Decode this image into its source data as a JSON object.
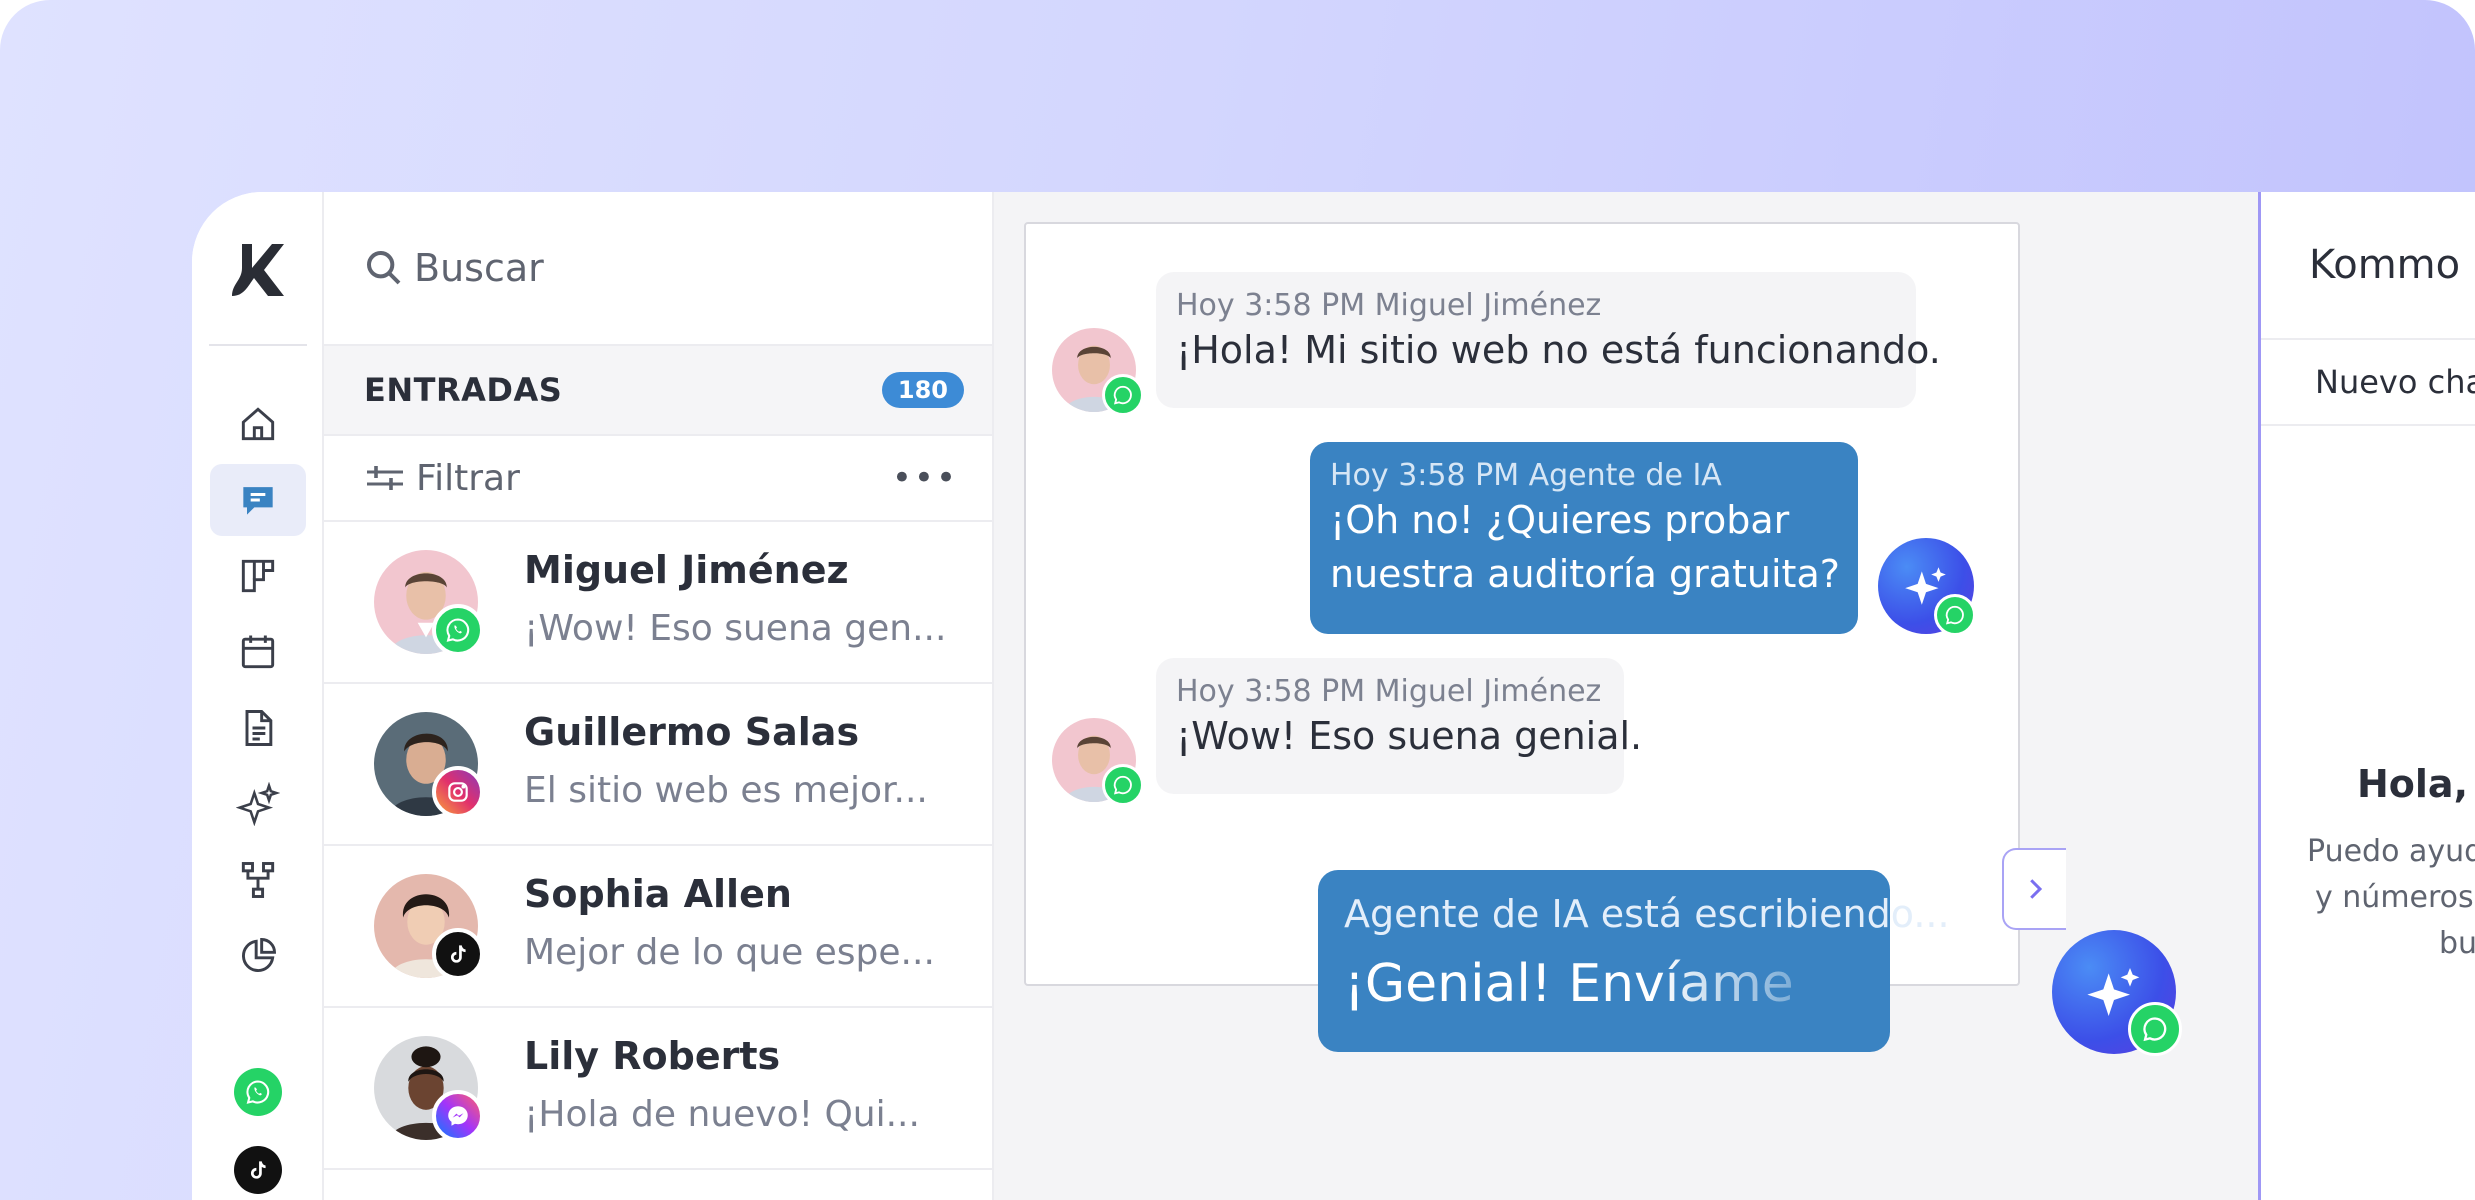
{
  "search": {
    "placeholder": "Buscar"
  },
  "inbox": {
    "title": "ENTRADAS",
    "count": "180"
  },
  "filter": {
    "label": "Filtrar",
    "more": "•••"
  },
  "conversations": [
    {
      "name": "Miguel Jiménez",
      "preview": "¡Wow! Eso suena gen...",
      "channel": "whatsapp"
    },
    {
      "name": "Guillermo Salas",
      "preview": "El sitio web es mejor...",
      "channel": "instagram"
    },
    {
      "name": "Sophia Allen",
      "preview": "Mejor de lo que espe...",
      "channel": "tiktok"
    },
    {
      "name": "Lily Roberts",
      "preview": "¡Hola de nuevo! Qui...",
      "channel": "messenger"
    }
  ],
  "messages": [
    {
      "meta": "Hoy 3:58 PM Miguel Jiménez",
      "text": "¡Hola! Mi sitio web no está funcionando."
    },
    {
      "meta": "Hoy 3:58 PM Agente de IA",
      "line1": "¡Oh no! ¿Quieres probar",
      "line2": "nuestra auditoría gratuita?"
    },
    {
      "meta": "Hoy 3:58 PM Miguel Jiménez",
      "text": "¡Wow! Eso suena genial."
    }
  ],
  "typing": {
    "meta": "Agente de IA está escribiendo...",
    "text": "¡Genial! Envíame"
  },
  "copilot": {
    "title": "Kommo Copilot",
    "tab": "Nuevo chat",
    "heading": "Hola, soy el Analis",
    "desc1": "Puedo ayudarte a analizar",
    "desc2": "y números para mantener",
    "desc3": "buen camino"
  },
  "colors": {
    "accent": "#3a83c2",
    "copilot_border": "#9f97f5",
    "whatsapp": "#25d366"
  }
}
